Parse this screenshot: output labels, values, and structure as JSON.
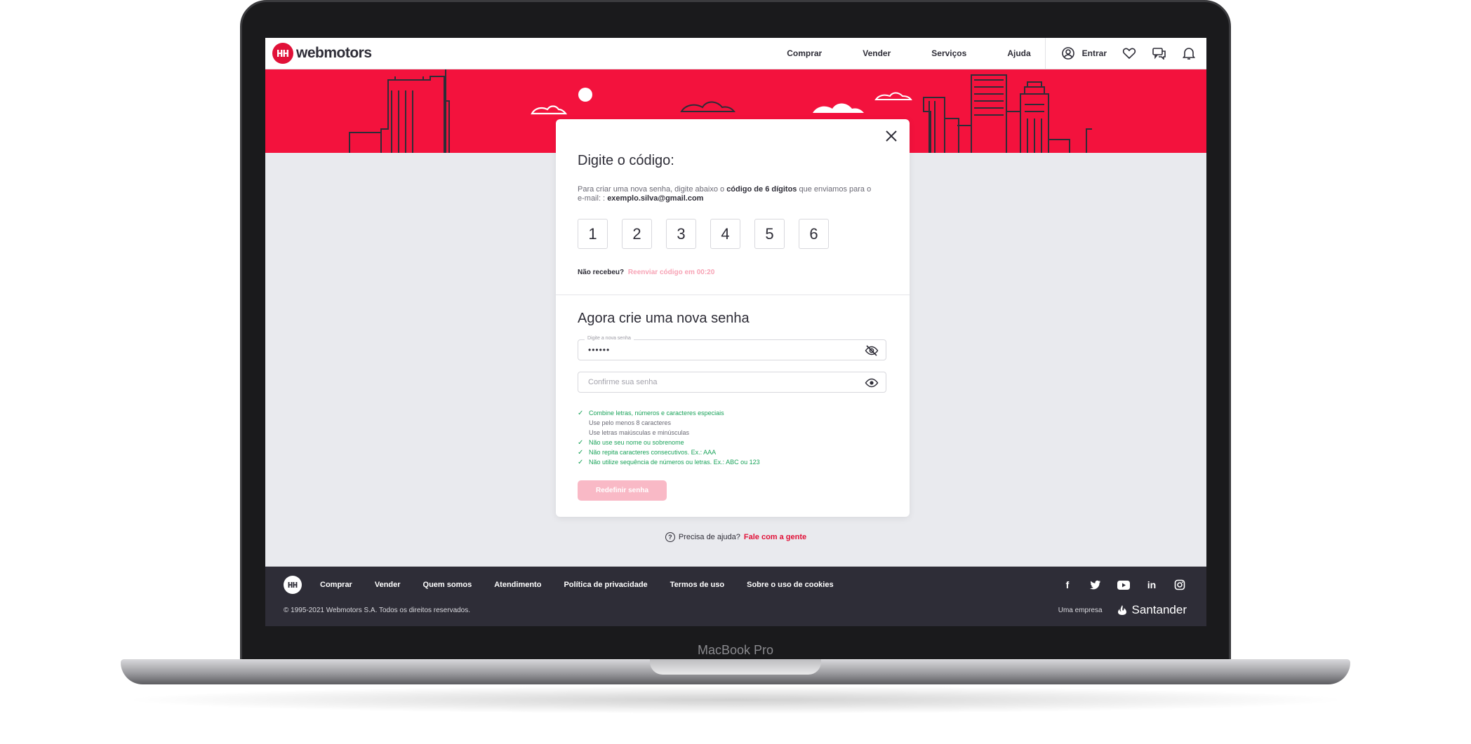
{
  "device": {
    "label": "MacBook Pro"
  },
  "header": {
    "brand": "webmotors",
    "brand_mark": "H",
    "nav": [
      "Comprar",
      "Vender",
      "Serviços",
      "Ajuda"
    ],
    "login_label": "Entrar"
  },
  "modal": {
    "code_title": "Digite o código:",
    "code_desc_prefix": "Para criar uma nova senha, digite abaixo o ",
    "code_desc_bold": "código de 6 dígitos",
    "code_desc_mid": " que enviamos para o e-mail: : ",
    "email": "exemplo.silva@gmail.com",
    "code_digits": [
      "1",
      "2",
      "3",
      "4",
      "5",
      "6"
    ],
    "resend_prefix": "Não recebeu?",
    "resend_link": "Reenviar código em 00:20",
    "password_title": "Agora crie uma nova senha",
    "new_password_label": "Digite a nova senha",
    "new_password_value": "••••••",
    "confirm_placeholder": "Confirme sua senha",
    "rules": [
      {
        "text": "Combine letras, números e caracteres especiais",
        "status": "ok"
      },
      {
        "text": "Use pelo menos 8 caracteres",
        "status": "sub"
      },
      {
        "text": "Use letras maiúsculas e minúsculas",
        "status": "sub"
      },
      {
        "text": "Não use seu nome ou sobrenome",
        "status": "ok"
      },
      {
        "text": "Não repita caracteres consecutivos. Ex.: AAA",
        "status": "ok"
      },
      {
        "text": "Não utilize sequência de números ou letras. Ex.: ABC ou 123",
        "status": "ok"
      }
    ],
    "submit_label": "Redefinir senha"
  },
  "help": {
    "prefix": "Precisa de ajuda?",
    "link": "Fale com a gente"
  },
  "footer": {
    "links": [
      "Comprar",
      "Vender",
      "Quem somos",
      "Atendimento",
      "Política de privacidade",
      "Termos de uso",
      "Sobre o uso de cookies"
    ],
    "social_icons": [
      "facebook-icon",
      "twitter-icon",
      "youtube-icon",
      "linkedin-icon",
      "instagram-icon"
    ],
    "copyright": "© 1995-2021 Webmotors S.A. Todos os direitos reservados.",
    "company_label": "Uma empresa",
    "company_name": "Santander"
  },
  "colors": {
    "brand_red": "#f3123d",
    "footer_bg": "#2e2d37",
    "success_green": "#1aa35a",
    "button_disabled": "#f9b9c6"
  }
}
